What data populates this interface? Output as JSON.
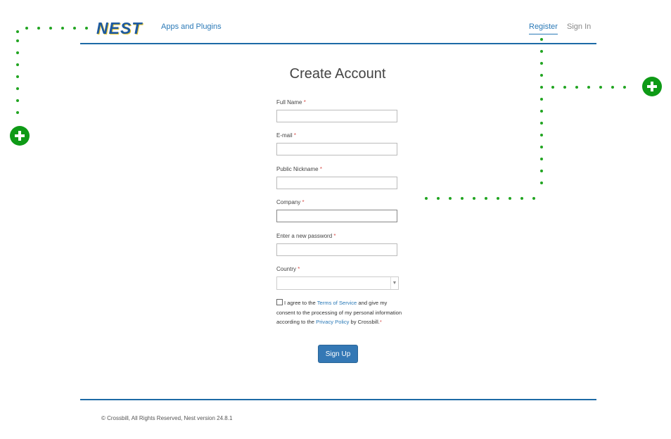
{
  "header": {
    "logo_text": "NEST",
    "nav_apps": "Apps and Plugins",
    "nav_register": "Register",
    "nav_signin": "Sign In"
  },
  "form": {
    "title": "Create Account",
    "required_marker": "*",
    "fields": [
      {
        "label": "Full Name",
        "value": ""
      },
      {
        "label": "E-mail",
        "value": ""
      },
      {
        "label": "Public Nickname",
        "value": ""
      },
      {
        "label": "Company",
        "value": ""
      },
      {
        "label": "Enter a new password",
        "value": ""
      },
      {
        "label": "Country",
        "value": ""
      }
    ],
    "agree": {
      "text_1": "I agree to the ",
      "terms_link": "Terms of Service",
      "text_2": " and give my consent to the processing of my personal information according to the ",
      "privacy_link": "Privacy Policy",
      "text_3": " by Crossbill.",
      "required_marker": "*"
    },
    "submit_label": "Sign Up"
  },
  "footer": {
    "text": "© Crossbill, All Rights Reserved, Nest version 24.8.1"
  },
  "colors": {
    "accent": "#2a79b7",
    "rule": "#1d6aa6",
    "button": "#3478b5",
    "annotation": "#0e9a16"
  },
  "icons": [
    "plus-circle-icon",
    "select-arrow-icon"
  ]
}
